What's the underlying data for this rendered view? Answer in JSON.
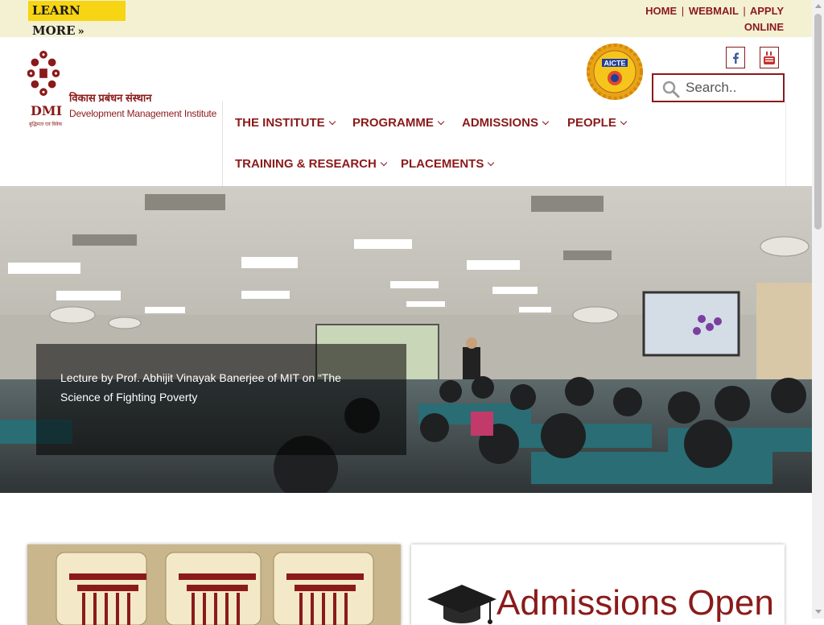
{
  "topbar": {
    "learn_more": "LEARN  MORE",
    "learn_more_icon": "double-chevron-right",
    "links": {
      "home": "HOME",
      "webmail": "WEBMAIL",
      "apply": "APPLY ONLINE"
    },
    "separator": "|"
  },
  "logo": {
    "abbrev": "DMI",
    "hindi_name": "विकास प्रबंधन संस्थान",
    "english_name": "Development Management Institute",
    "small_text": "बुद्धिमता एवं विवेक"
  },
  "header": {
    "badge_text": "AICTE",
    "social": [
      {
        "name": "facebook",
        "icon": "facebook-icon",
        "glyph": "f"
      },
      {
        "name": "youtube",
        "icon": "youtube-icon",
        "glyph": "You"
      }
    ],
    "search": {
      "placeholder": "Search..",
      "value": ""
    }
  },
  "nav": {
    "items": [
      {
        "label": "THE INSTITUTE"
      },
      {
        "label": "PROGRAMME"
      },
      {
        "label": "ADMISSIONS"
      },
      {
        "label": "PEOPLE"
      },
      {
        "label": "TRAINING & RESEARCH"
      },
      {
        "label": "PLACEMENTS"
      }
    ]
  },
  "hero": {
    "caption": "Lecture by Prof. Abhijit Vinayak Banerjee of MIT on “The Science of Fighting Poverty"
  },
  "cards": {
    "right_title": "Admissions Open"
  },
  "colors": {
    "brand": "#8b1a1a",
    "topbar_bg": "#f4f1d3",
    "learn_more_bg": "#f7d414"
  }
}
